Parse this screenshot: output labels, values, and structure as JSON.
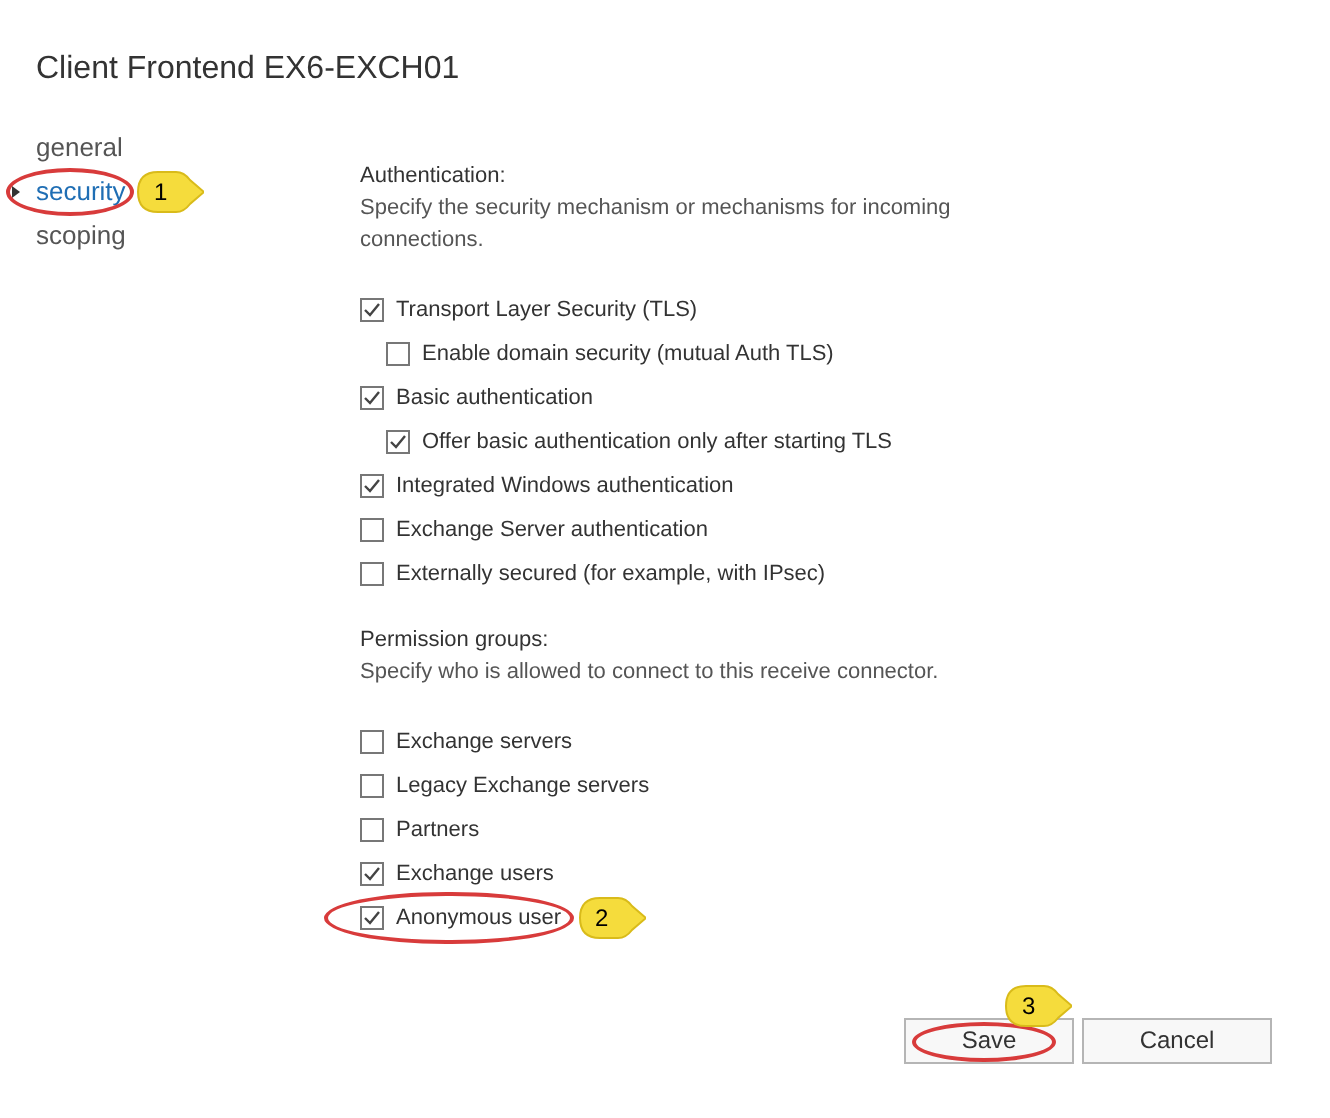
{
  "title": "Client Frontend EX6-EXCH01",
  "nav": [
    {
      "label": "general",
      "selected": false
    },
    {
      "label": "security",
      "selected": true,
      "circled": true,
      "callout": "1"
    },
    {
      "label": "scoping",
      "selected": false
    }
  ],
  "authentication": {
    "heading": "Authentication:",
    "description": "Specify the security mechanism or mechanisms for incoming connections.",
    "options": [
      {
        "label": "Transport Layer Security (TLS)",
        "checked": true,
        "children": [
          {
            "label": "Enable domain security (mutual Auth TLS)",
            "checked": false
          }
        ]
      },
      {
        "label": "Basic authentication",
        "checked": true,
        "children": [
          {
            "label": "Offer basic authentication only after starting TLS",
            "checked": true
          }
        ]
      },
      {
        "label": "Integrated Windows authentication",
        "checked": true
      },
      {
        "label": "Exchange Server authentication",
        "checked": false
      },
      {
        "label": "Externally secured (for example, with IPsec)",
        "checked": false
      }
    ]
  },
  "permission_groups": {
    "heading": "Permission groups:",
    "description": "Specify who is allowed to connect to this receive connector.",
    "options": [
      {
        "label": "Exchange servers",
        "checked": false
      },
      {
        "label": "Legacy Exchange servers",
        "checked": false
      },
      {
        "label": "Partners",
        "checked": false
      },
      {
        "label": "Exchange users",
        "checked": true
      },
      {
        "label": "Anonymous user",
        "checked": true,
        "circled": true,
        "callout": "2"
      }
    ]
  },
  "buttons": [
    {
      "label": "Save",
      "circled": true,
      "callout": "3"
    },
    {
      "label": "Cancel"
    }
  ]
}
